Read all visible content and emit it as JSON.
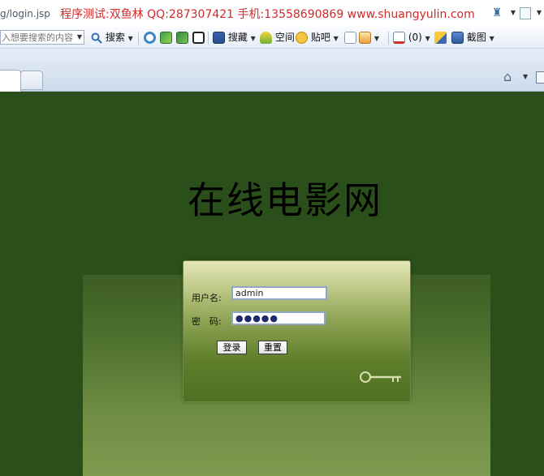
{
  "browser": {
    "url": "g/login.jsp",
    "ad_text": "程序测试:双鱼林 QQ:287307421 手机:13558690869 www.shuangyulin.com"
  },
  "toolbar": {
    "search_placeholder": "入想要搜索的内容",
    "search_label": "搜索",
    "bookmarks_label": "搜藏",
    "space_label": "空间",
    "tieba_label": "贴吧",
    "mail_count": "(0)",
    "screenshot_label": "截图",
    "icons": [
      "dropdown-icon",
      "search-icon",
      "app-icon",
      "image-icon",
      "translate-icon",
      "film-icon",
      "bookmark-icon",
      "space-icon",
      "chat-icon",
      "mail-icon",
      "note-icon",
      "mail-alert-icon",
      "pen-icon",
      "screenshot-icon"
    ]
  },
  "page": {
    "title": "在线电影网",
    "username_label": "用户名:",
    "password_label": "密　码:",
    "username_value": "admin",
    "password_value": "●●●●●",
    "login_button": "登录",
    "reset_button": "重置"
  },
  "colors": {
    "page_bg": "#2b4f1a",
    "ad_text": "#d02a2a"
  }
}
